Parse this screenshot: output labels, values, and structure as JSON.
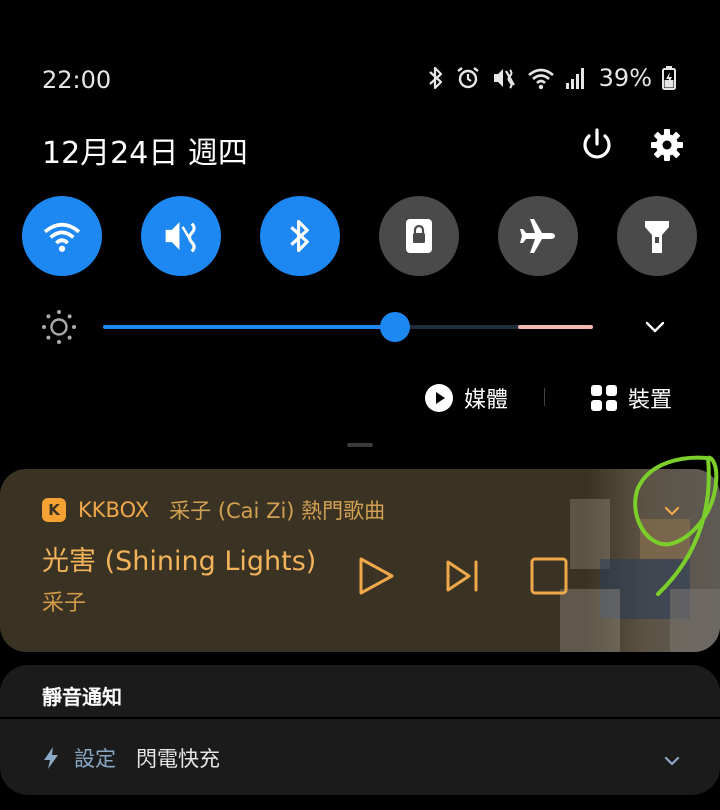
{
  "status_bar": {
    "time": "22:00",
    "battery": "39%",
    "icons": [
      "bluetooth-icon",
      "alarm-icon",
      "vibrate-icon",
      "wifi-icon",
      "signal-icon",
      "battery-charging-icon"
    ]
  },
  "header": {
    "date": "12月24日 週四"
  },
  "quick_tiles": [
    {
      "name": "wifi",
      "icon": "wifi-icon",
      "state": "on"
    },
    {
      "name": "vibrate",
      "icon": "vibrate-icon",
      "state": "on"
    },
    {
      "name": "bluetooth",
      "icon": "bluetooth-icon",
      "state": "on"
    },
    {
      "name": "screen-lock",
      "icon": "lock-icon",
      "state": "off"
    },
    {
      "name": "airplane",
      "icon": "airplane-icon",
      "state": "off"
    },
    {
      "name": "flashlight",
      "icon": "flashlight-icon",
      "state": "off"
    }
  ],
  "brightness": {
    "level": 0.595
  },
  "outputs": {
    "media_label": "媒體",
    "devices_label": "裝置"
  },
  "media_card": {
    "app_name": "KKBOX",
    "app_icon_letter": "K",
    "playlist": "采子 (Cai Zi) 熱門歌曲",
    "song_title": "光害 (Shining Lights)",
    "artist": "采子",
    "accent_color": "#f0a84a"
  },
  "silent_notifications": {
    "title": "靜音通知",
    "app": "設定",
    "text": "閃電快充"
  },
  "colors": {
    "tile_on": "#1e88f2",
    "tile_off": "#4a4a4a",
    "annotation": "#7ccf2a"
  }
}
